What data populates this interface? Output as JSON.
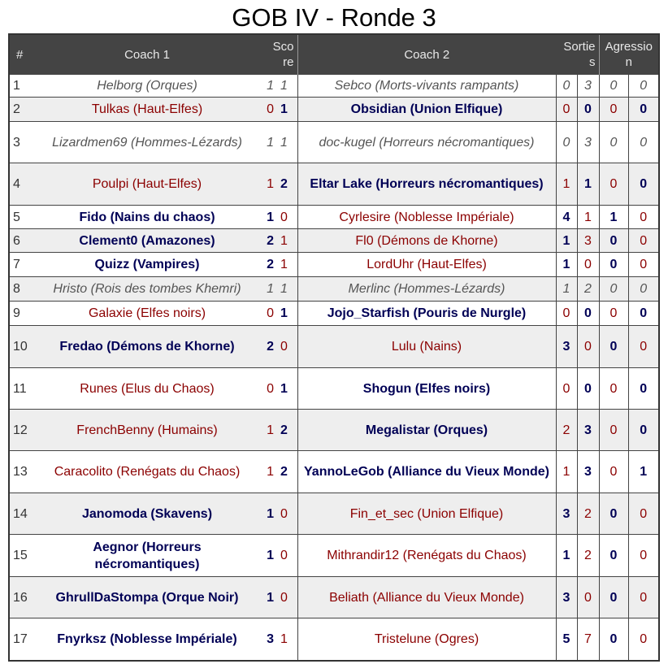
{
  "title": "GOB IV - Ronde 3",
  "headers": {
    "num": "#",
    "coach1": "Coach 1",
    "score": "Score",
    "coach2": "Coach 2",
    "sorties": "Sorties",
    "agression": "Agression"
  },
  "colors": {
    "win": "#000055",
    "loss": "#8b0000",
    "draw": "#555555",
    "header_bg": "#444444",
    "alt_row_bg": "#eeeeee"
  },
  "rows": [
    {
      "n": "1",
      "c1": "Helborg (Orques)",
      "s1": "1",
      "s2": "1",
      "c2": "Sebco (Morts-vivants rampants)",
      "so1": "0",
      "so2": "3",
      "a1": "0",
      "a2": "0",
      "r": "draw"
    },
    {
      "n": "2",
      "c1": "Tulkas (Haut-Elfes)",
      "s1": "0",
      "s2": "1",
      "c2": "Obsidian (Union Elfique)",
      "so1": "0",
      "so2": "0",
      "a1": "0",
      "a2": "0",
      "r": "c2"
    },
    {
      "n": "3",
      "c1": "Lizardmen69 (Hommes-Lézards)",
      "s1": "1",
      "s2": "1",
      "c2": "doc-kugel (Horreurs nécromantiques)",
      "so1": "0",
      "so2": "3",
      "a1": "0",
      "a2": "0",
      "r": "draw"
    },
    {
      "n": "4",
      "c1": "Poulpi (Haut-Elfes)",
      "s1": "1",
      "s2": "2",
      "c2": "Eltar Lake (Horreurs nécromantiques)",
      "so1": "1",
      "so2": "1",
      "a1": "0",
      "a2": "0",
      "r": "c2"
    },
    {
      "n": "5",
      "c1": "Fido (Nains du chaos)",
      "s1": "1",
      "s2": "0",
      "c2": "Cyrlesire (Noblesse Impériale)",
      "so1": "4",
      "so2": "1",
      "a1": "1",
      "a2": "0",
      "r": "c1"
    },
    {
      "n": "6",
      "c1": "Clement0 (Amazones)",
      "s1": "2",
      "s2": "1",
      "c2": "Fl0 (Démons de Khorne)",
      "so1": "1",
      "so2": "3",
      "a1": "0",
      "a2": "0",
      "r": "c1"
    },
    {
      "n": "7",
      "c1": "Quizz (Vampires)",
      "s1": "2",
      "s2": "1",
      "c2": "LordUhr (Haut-Elfes)",
      "so1": "1",
      "so2": "0",
      "a1": "0",
      "a2": "0",
      "r": "c1"
    },
    {
      "n": "8",
      "c1": "Hristo (Rois des tombes Khemri)",
      "s1": "1",
      "s2": "1",
      "c2": "Merlinc (Hommes-Lézards)",
      "so1": "1",
      "so2": "2",
      "a1": "0",
      "a2": "0",
      "r": "draw"
    },
    {
      "n": "9",
      "c1": "Galaxie (Elfes noirs)",
      "s1": "0",
      "s2": "1",
      "c2": "Jojo_Starfish (Pouris de Nurgle)",
      "so1": "0",
      "so2": "0",
      "a1": "0",
      "a2": "0",
      "r": "c2"
    },
    {
      "n": "10",
      "c1": "Fredao (Démons de Khorne)",
      "s1": "2",
      "s2": "0",
      "c2": "Lulu (Nains)",
      "so1": "3",
      "so2": "0",
      "a1": "0",
      "a2": "0",
      "r": "c1"
    },
    {
      "n": "11",
      "c1": "Runes (Elus du Chaos)",
      "s1": "0",
      "s2": "1",
      "c2": "Shogun (Elfes noirs)",
      "so1": "0",
      "so2": "0",
      "a1": "0",
      "a2": "0",
      "r": "c2"
    },
    {
      "n": "12",
      "c1": "FrenchBenny (Humains)",
      "s1": "1",
      "s2": "2",
      "c2": "Megalistar (Orques)",
      "so1": "2",
      "so2": "3",
      "a1": "0",
      "a2": "0",
      "r": "c2"
    },
    {
      "n": "13",
      "c1": "Caracolito (Renégats du Chaos)",
      "s1": "1",
      "s2": "2",
      "c2": "YannoLeGob (Alliance du Vieux Monde)",
      "so1": "1",
      "so2": "3",
      "a1": "0",
      "a2": "1",
      "r": "c2"
    },
    {
      "n": "14",
      "c1": "Janomoda (Skavens)",
      "s1": "1",
      "s2": "0",
      "c2": "Fin_et_sec (Union Elfique)",
      "so1": "3",
      "so2": "2",
      "a1": "0",
      "a2": "0",
      "r": "c1"
    },
    {
      "n": "15",
      "c1": "Aegnor (Horreurs nécromantiques)",
      "s1": "1",
      "s2": "0",
      "c2": "Mithrandir12 (Renégats du Chaos)",
      "so1": "1",
      "so2": "2",
      "a1": "0",
      "a2": "0",
      "r": "c1"
    },
    {
      "n": "16",
      "c1": "GhrullDaStompa (Orque Noir)",
      "s1": "1",
      "s2": "0",
      "c2": "Beliath (Alliance du Vieux Monde)",
      "so1": "3",
      "so2": "0",
      "a1": "0",
      "a2": "0",
      "r": "c1"
    },
    {
      "n": "17",
      "c1": "Fnyrksz (Noblesse Impériale)",
      "s1": "3",
      "s2": "1",
      "c2": "Tristelune (Ogres)",
      "so1": "5",
      "so2": "7",
      "a1": "0",
      "a2": "0",
      "r": "c1"
    }
  ]
}
